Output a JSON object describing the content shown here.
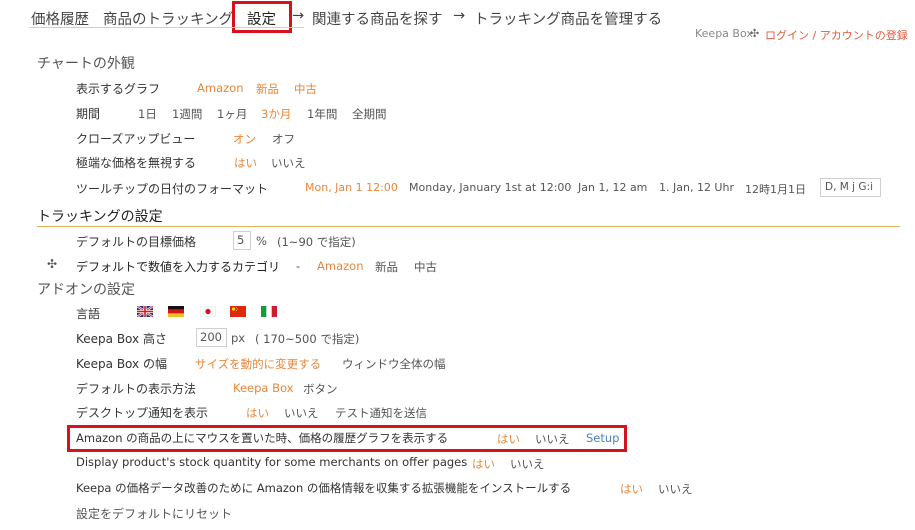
{
  "tabs": {
    "history": "価格履歴",
    "tracking": "商品のトラッキング",
    "settings": "設定",
    "related": "関連する商品を探す",
    "manage": "トラッキング商品を管理する",
    "arrow": "→"
  },
  "account": {
    "brand": "Keepa Box",
    "separator": "✣",
    "login": "ログイン / アカウントの登録"
  },
  "chart_section": {
    "title": "チャートの外観",
    "graphs": {
      "label": "表示するグラフ",
      "options": [
        "Amazon",
        "新品",
        "中古"
      ]
    },
    "period": {
      "label": "期間",
      "options": [
        "1日",
        "1週間",
        "1ヶ月",
        "3か月",
        "1年間",
        "全期間"
      ]
    },
    "closeup": {
      "label": "クローズアップビュー",
      "options": [
        "オン",
        "オフ"
      ]
    },
    "extreme": {
      "label": "極端な価格を無視する",
      "options": [
        "はい",
        "いいえ"
      ]
    },
    "tooltip": {
      "label": "ツールチップの日付のフォーマット",
      "options": [
        "Mon, Jan 1 12:00",
        "Monday, January 1st at 12:00",
        "Jan 1, 12 am",
        "1. Jan, 12 Uhr",
        "12時1月1日"
      ],
      "custom": "D, M j G:i"
    }
  },
  "tracking_section": {
    "title": "トラッキングの設定",
    "target": {
      "label": "デフォルトの目標価格",
      "value": "5",
      "unit": "%",
      "hint": "(1~90 で指定)"
    },
    "category": {
      "icon": "✣",
      "label": "デフォルトで数値を入力するカテゴリ",
      "dash": "-",
      "options": [
        "Amazon",
        "新品",
        "中古"
      ]
    }
  },
  "addon_section": {
    "title": "アドオンの設定",
    "language": {
      "label": "言語",
      "flags": [
        "UK",
        "DE",
        "JP",
        "CN",
        "IT"
      ]
    },
    "height": {
      "label": "Keepa Box 高さ",
      "value": "200",
      "unit": "px",
      "hint": "( 170~500 で指定)"
    },
    "width": {
      "label": "Keepa Box の幅",
      "options": [
        "サイズを動的に変更する",
        "ウィンドウ全体の幅"
      ]
    },
    "display": {
      "label": "デフォルトの表示方法",
      "options": [
        "Keepa Box",
        "ボタン"
      ]
    },
    "notify": {
      "label": "デスクトップ通知を表示",
      "options": [
        "はい",
        "いいえ",
        "テスト通知を送信"
      ]
    },
    "hover": {
      "label": "Amazon の商品の上にマウスを置いた時、価格の履歴グラフを表示する",
      "options": [
        "はい",
        "いいえ",
        "Setup"
      ]
    },
    "stock": {
      "label": "Display product's stock quantity for some merchants on offer pages",
      "options": [
        "はい",
        "いいえ"
      ]
    },
    "collect": {
      "label": "Keepa の価格データ改善のために Amazon の価格情報を収集する拡張機能をインストールする",
      "options": [
        "はい",
        "いいえ"
      ]
    },
    "reset": "設定をデフォルトにリセット"
  },
  "colors": {
    "selected": "#e8873a",
    "highlight": "#d6121d",
    "link_blue": "#4a82c3",
    "divider_gold": "#e0b45c"
  }
}
